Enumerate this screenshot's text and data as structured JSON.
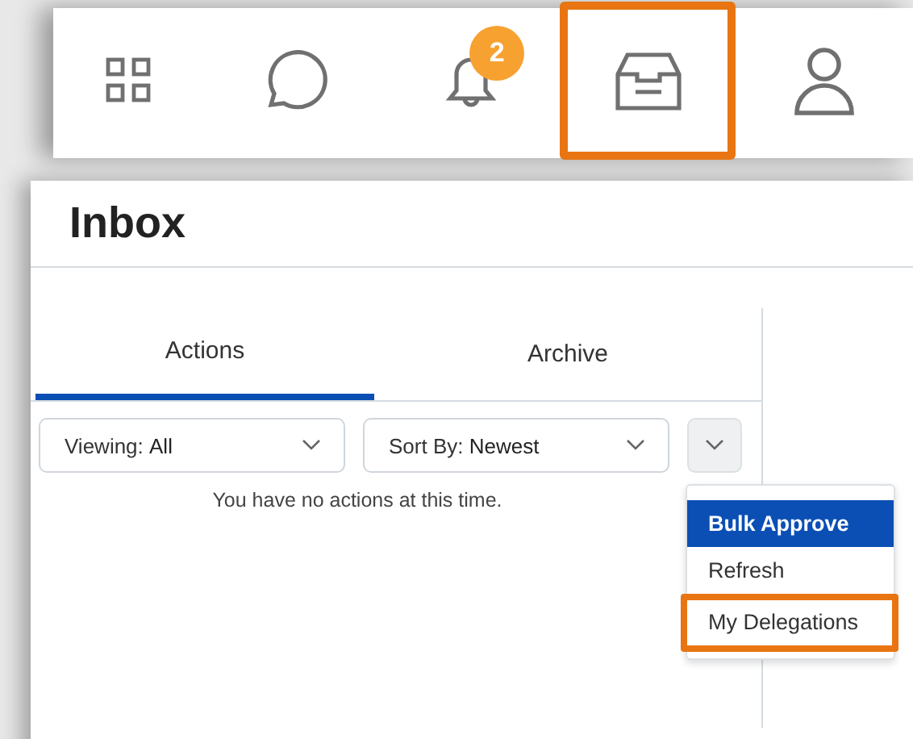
{
  "nav": [
    {
      "kind": "grid",
      "highlighted": false
    },
    {
      "kind": "chat",
      "highlighted": false
    },
    {
      "kind": "bell",
      "highlighted": false,
      "badge": "2"
    },
    {
      "kind": "inbox",
      "highlighted": true
    },
    {
      "kind": "person",
      "highlighted": false
    }
  ],
  "page": {
    "title": "Inbox"
  },
  "tabs": [
    {
      "label": "Actions",
      "selected": true
    },
    {
      "label": "Archive",
      "selected": false
    }
  ],
  "filters": [
    {
      "label": "Viewing:",
      "value": "All"
    },
    {
      "label": "Sort By:",
      "value": "Newest"
    }
  ],
  "empty_message": "You have no actions at this time.",
  "menu": [
    {
      "label": "Bulk Approve",
      "selected": true,
      "highlighted": false
    },
    {
      "label": "Refresh",
      "selected": false,
      "highlighted": false
    },
    {
      "label": "My Delegations",
      "selected": false,
      "highlighted": true
    }
  ]
}
